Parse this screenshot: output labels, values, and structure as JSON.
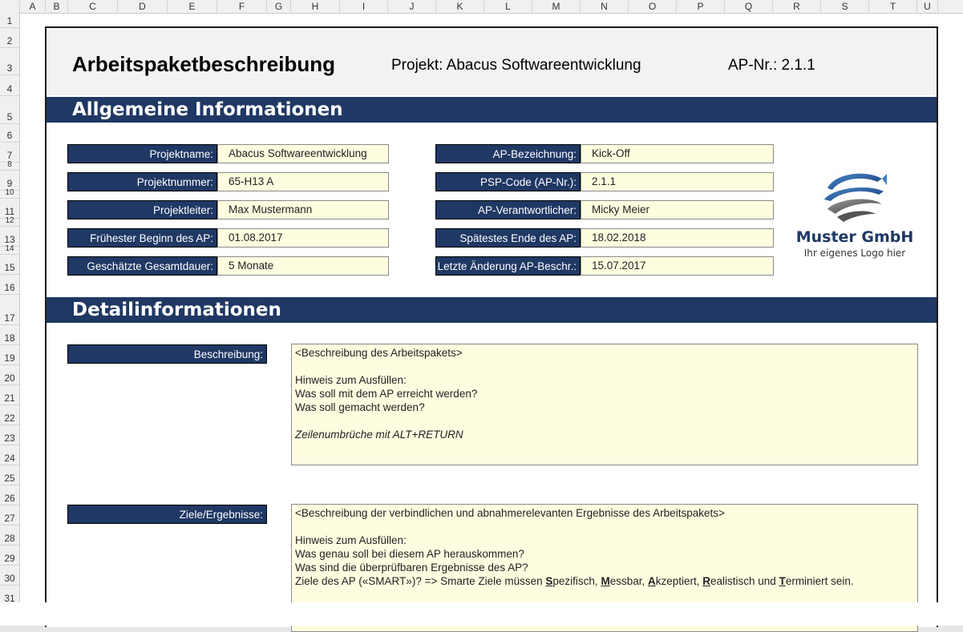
{
  "columns": [
    "",
    "A",
    "B",
    "C",
    "D",
    "E",
    "F",
    "G",
    "H",
    "I",
    "J",
    "K",
    "L",
    "M",
    "N",
    "O",
    "P",
    "Q",
    "R",
    "S",
    "T",
    "U"
  ],
  "rows": [
    "1",
    "2",
    "3",
    "4",
    "5",
    "6",
    "7",
    "8",
    "9",
    "10",
    "11",
    "12",
    "13",
    "14",
    "15",
    "16",
    "17",
    "18",
    "19",
    "20",
    "21",
    "22",
    "23",
    "24",
    "25",
    "26",
    "27",
    "28",
    "29",
    "30",
    "31"
  ],
  "header": {
    "title": "Arbeitspaketbeschreibung",
    "projekt": "Projekt: Abacus Softwareentwicklung",
    "ap_nr": "AP-Nr.: 2.1.1"
  },
  "section1": {
    "title": "Allgemeine Informationen"
  },
  "left_fields": [
    {
      "label": "Projektname:",
      "value": "Abacus Softwareentwicklung"
    },
    {
      "label": "Projektnummer:",
      "value": "65-H13 A"
    },
    {
      "label": "Projektleiter:",
      "value": "Max Mustermann"
    },
    {
      "label": "Frühester Beginn des AP:",
      "value": "01.08.2017"
    },
    {
      "label": "Geschätzte Gesamtdauer:",
      "value": "5 Monate"
    }
  ],
  "right_fields": [
    {
      "label": "AP-Bezeichnung:",
      "value": "Kick-Off"
    },
    {
      "label": "PSP-Code (AP-Nr.):",
      "value": "2.1.1"
    },
    {
      "label": "AP-Verantwortlicher:",
      "value": "Micky Meier"
    },
    {
      "label": "Spätestes Ende des AP:",
      "value": "18.02.2018"
    },
    {
      "label": "Letzte Änderung AP-Beschr.:",
      "value": "15.07.2017"
    }
  ],
  "logo": {
    "company": "Muster GmbH",
    "tagline": "Ihr eigenes Logo hier"
  },
  "section2": {
    "title": "Detailinformationen"
  },
  "beschreibung": {
    "label": "Beschreibung:",
    "lines": [
      "<Beschreibung des Arbeitspakets>",
      "",
      "Hinweis zum Ausfüllen:",
      "Was soll mit dem AP erreicht werden?",
      "Was soll gemacht werden?",
      "",
      "Zeilenumbrüche mit ALT+RETURN"
    ]
  },
  "ziele": {
    "label": "Ziele/Ergebnisse:",
    "lines": [
      "<Beschreibung der verbindlichen und abnahmerelevanten Ergebnisse des Arbeitspakets>",
      "",
      "Hinweis zum Ausfüllen:",
      "Was genau soll bei diesem AP herauskommen?",
      "Was sind die überprüfbaren Ergebnisse des AP?"
    ],
    "smart_prefix": "Ziele des AP («SMART»)? => Smarte Ziele müssen ",
    "smart_parts": [
      {
        "letter": "S",
        "rest": "pezifisch, "
      },
      {
        "letter": "M",
        "rest": "essbar, "
      },
      {
        "letter": "A",
        "rest": "kzeptiert, "
      },
      {
        "letter": "R",
        "rest": "ealistisch und "
      },
      {
        "letter": "T",
        "rest": "erminiert sein."
      }
    ]
  },
  "colors": {
    "navy": "#1f3864",
    "cream": "#fffde0"
  }
}
